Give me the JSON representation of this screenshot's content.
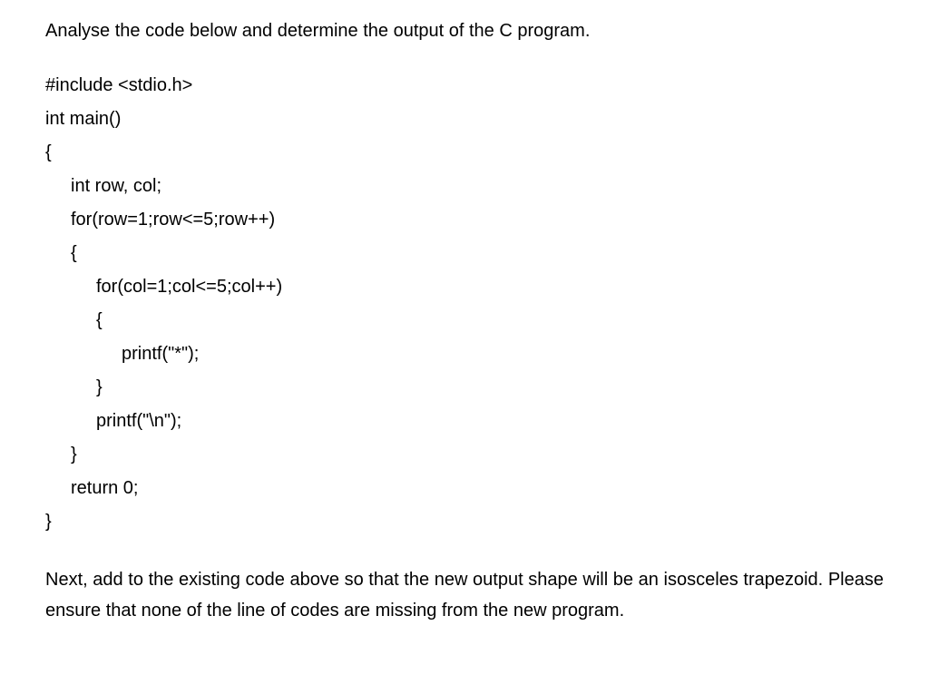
{
  "question": "Analyse the code below and determine the output of the C program.",
  "code": {
    "line1": "#include <stdio.h>",
    "line2": "int main()",
    "line3": "{",
    "line4": "int row, col;",
    "line5": "for(row=1;row<=5;row++)",
    "line6": "{",
    "line7": "for(col=1;col<=5;col++)",
    "line8": "{",
    "line9": "printf(\"*\");",
    "line10": "}",
    "line11": "printf(\"\\n\");",
    "line12": "}",
    "line13": "return 0;",
    "line14": "}"
  },
  "followup": "Next, add to the existing code above so that the new output shape will be an isosceles trapezoid. Please ensure that none of the line of codes are missing from the new program."
}
